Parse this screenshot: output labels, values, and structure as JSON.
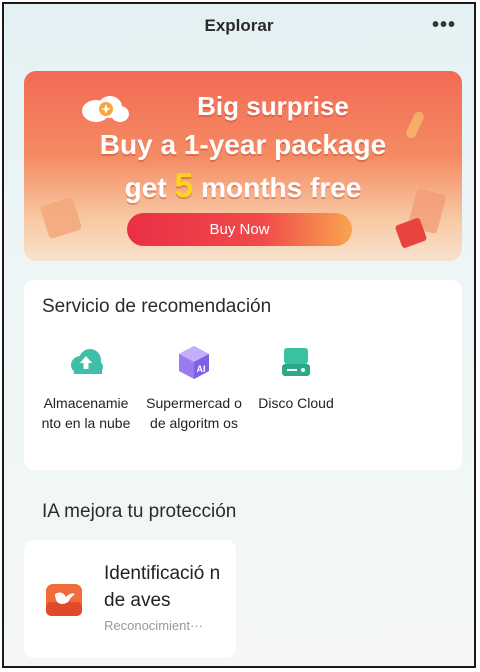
{
  "header": {
    "title": "Explorar",
    "more_icon": "more-icon",
    "more_glyph": "•••"
  },
  "banner": {
    "line1": "Big surprise",
    "line2": "Buy a 1-year package",
    "line3_prefix": "get ",
    "line3_number": "5",
    "line3_suffix": " months free",
    "button_label": "Buy Now",
    "colors": {
      "top": "#f36a55",
      "bottom": "#f7e2cd",
      "highlight": "#ffd21f",
      "button": "#ea2f45"
    }
  },
  "recommendation": {
    "title": "Servicio de recomendación",
    "items": [
      {
        "label": "Almacenamie nto en la nube",
        "icon": "cloud-upload-icon",
        "color": "#3fbfa8"
      },
      {
        "label": "Supermercad o de algoritm os",
        "icon": "ai-cube-icon",
        "color": "#9b7cf0"
      },
      {
        "label": "Disco Cloud",
        "icon": "cloud-disk-icon",
        "color": "#39c3a0"
      }
    ]
  },
  "ia_section": {
    "title": "IA mejora tu protección",
    "card": {
      "title": "Identificació n de aves",
      "subtitle": "Reconocimient···",
      "icon": "bird-icon",
      "color": "#f26b3a"
    }
  }
}
